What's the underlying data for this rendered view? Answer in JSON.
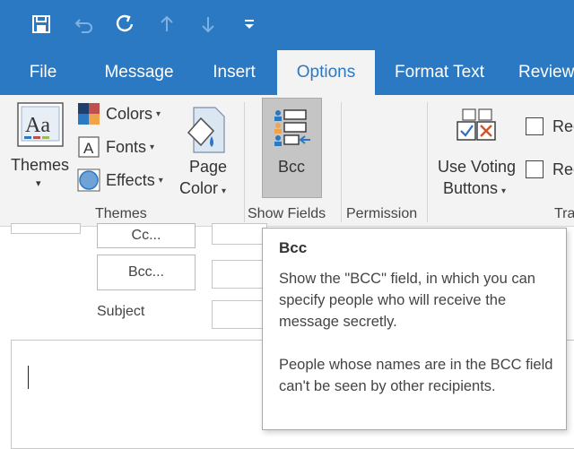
{
  "tabs": [
    "File",
    "Message",
    "Insert",
    "Options",
    "Format Text",
    "Review"
  ],
  "active_tab": "Options",
  "groups": {
    "themes": {
      "themes_button": {
        "line1": "Themes",
        "caret": "▾"
      },
      "colors": "Colors",
      "fonts": "Fonts",
      "effects": "Effects",
      "page_color": {
        "line1": "Page",
        "line2": "Color"
      },
      "label": "Themes"
    },
    "show_fields": {
      "bcc_button": "Bcc",
      "label": "Show Fields"
    },
    "permission": {
      "label": "Permission"
    },
    "tracking": {
      "voting_button": {
        "line1": "Use Voting",
        "line2": "Buttons"
      },
      "check1": "Rec",
      "check2": "Rec",
      "label": "Tra"
    }
  },
  "compose": {
    "cc_button": "Cc...",
    "bcc_button": "Bcc...",
    "subject_label": "Subject"
  },
  "tooltip": {
    "title": "Bcc",
    "paragraph1": "Show the \"BCC\" field, in which you can specify people who will receive the message secretly.",
    "paragraph2": "People whose names are in the BCC field can't be seen by other recipients."
  },
  "colors": {
    "ribbon_blue": "#2b79c2",
    "ribbon_bg": "#f3f3f3",
    "pressed_button": "#c5c5c5"
  }
}
